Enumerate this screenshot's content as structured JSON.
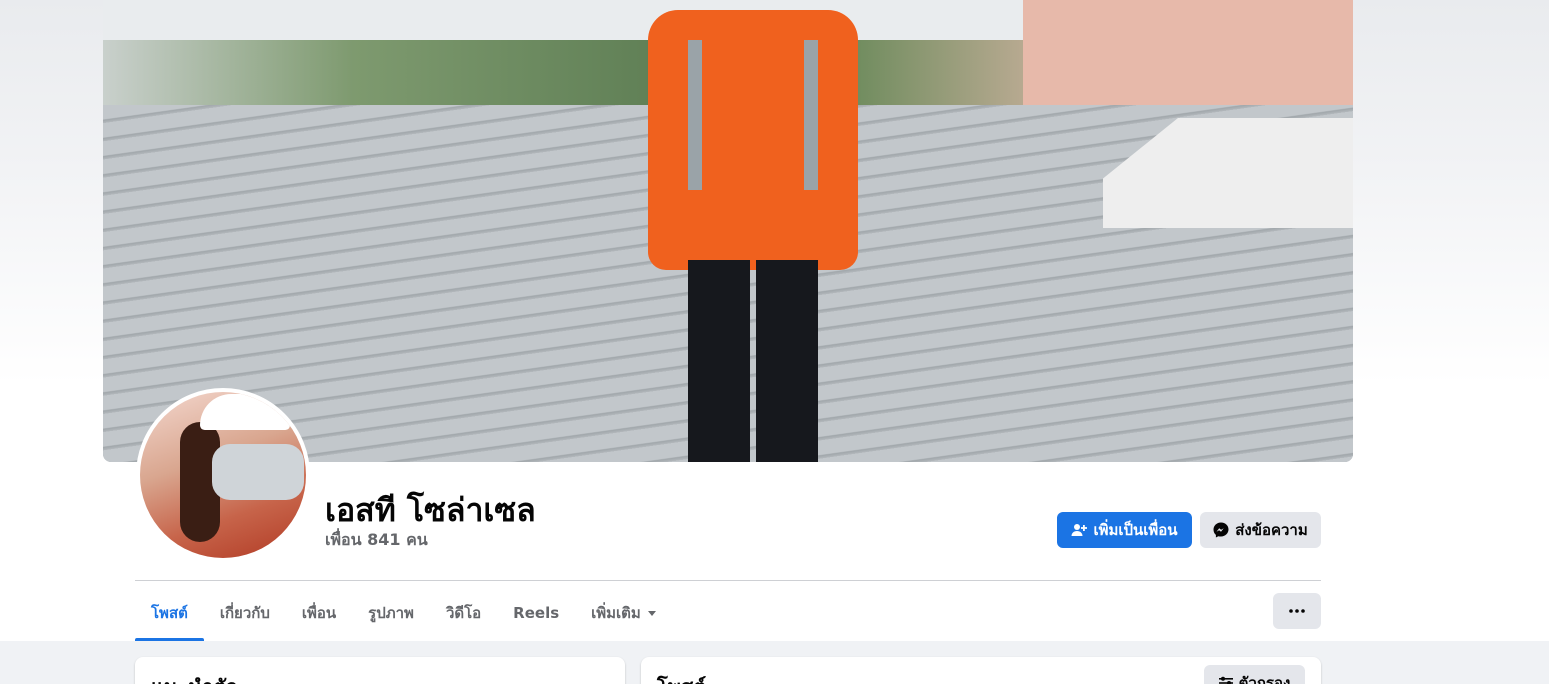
{
  "profile": {
    "name": "เอสที โซล่าเซล",
    "friends_text": "เพื่อน 841 คน"
  },
  "actions": {
    "add_friend_label": "เพิ่มเป็นเพื่อน",
    "message_label": "ส่งข้อความ",
    "more_label": "···"
  },
  "tabs": [
    {
      "label": "โพสต์",
      "active": true
    },
    {
      "label": "เกี่ยวกับ"
    },
    {
      "label": "เพื่อน"
    },
    {
      "label": "รูปภาพ"
    },
    {
      "label": "วิดีโอ"
    },
    {
      "label": "Reels"
    },
    {
      "label": "เพิ่มเติม"
    }
  ],
  "intro_card": {
    "title": "แนะนำตัว"
  },
  "posts_card": {
    "title": "โพสต์",
    "filter_label": "ตัวกรอง"
  },
  "colors": {
    "primary": "#1b74e4",
    "secondary_bg": "#e4e6eb",
    "page_bg": "#f0f2f5"
  },
  "icons": [
    "add-friend-icon",
    "messenger-icon",
    "dropdown-arrow-icon",
    "more-dots-icon",
    "filter-icon"
  ]
}
